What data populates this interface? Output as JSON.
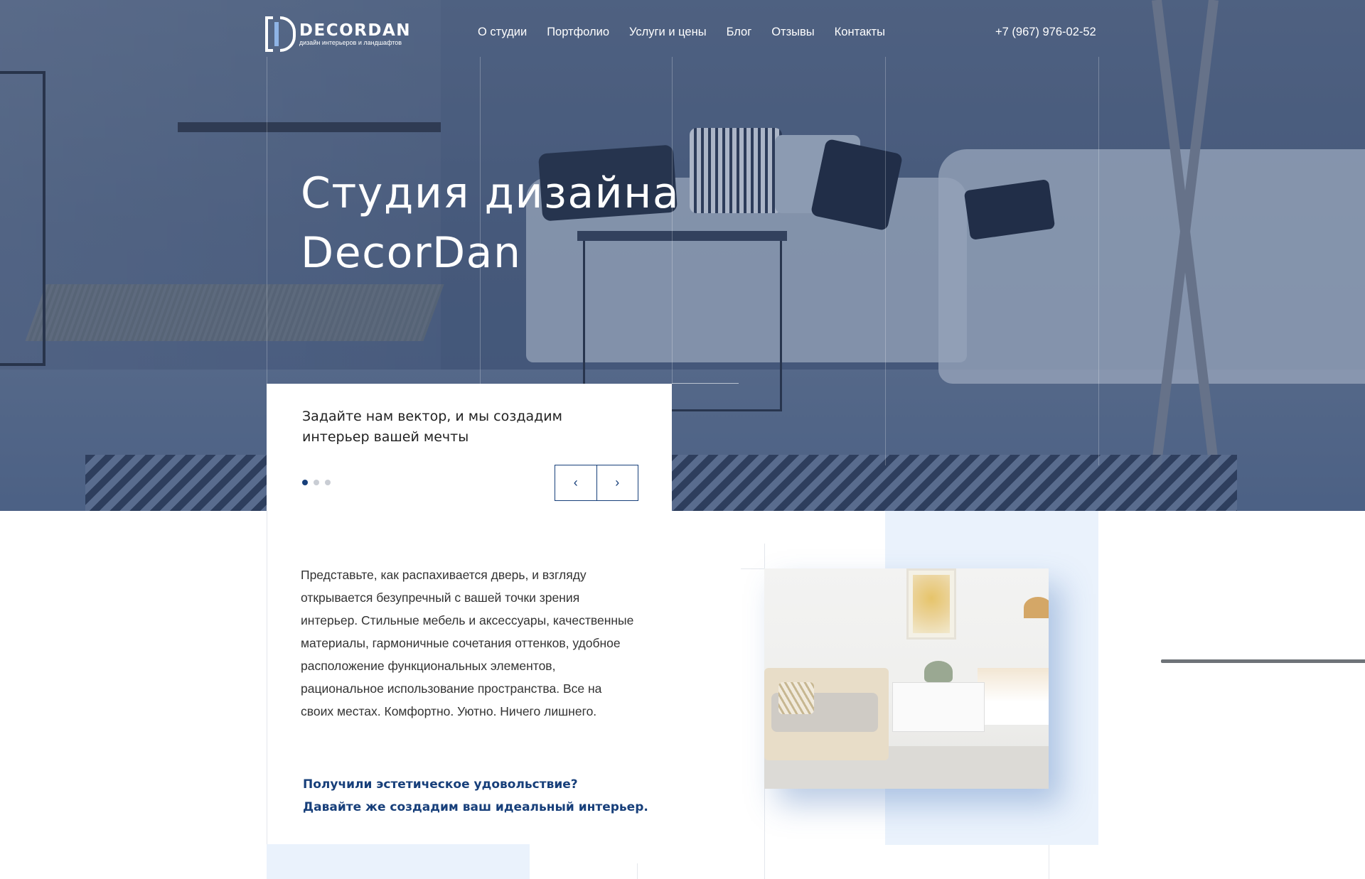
{
  "brand": {
    "name": "DECORDAN",
    "tagline": "дизайн интерьеров и ландшафтов"
  },
  "nav": {
    "items": [
      "О студии",
      "Портфолио",
      "Услуги и цены",
      "Блог",
      "Отзывы",
      "Контакты"
    ]
  },
  "header": {
    "phone": "+7 (967) 976-02-52"
  },
  "hero": {
    "title_line1": "Студия дизайна",
    "title_line2": "DecorDan"
  },
  "slider": {
    "text_line1": "Задайте нам вектор, и мы создадим",
    "text_line2": "интерьер вашей мечты",
    "current_slide": 1,
    "total_slides": 3,
    "prev_icon": "chevron-left-icon",
    "next_icon": "chevron-right-icon",
    "prev_glyph": "‹",
    "next_glyph": "›"
  },
  "about": {
    "paragraph": "Представьте, как распахивается дверь, и взгляду открывается безупречный с вашей точки зрения интерьер. Стильные мебель и аксессуары, качественные материалы, гармоничные сочетания оттенков, удобное расположение функциональных элементов, рациональное использование пространства. Все на своих местах. Комфортно. Уютно. Ничего лишнего.",
    "cta_line1": "Получили эстетическое удовольствие?",
    "cta_line2": "Давайте же создадим ваш идеальный интерьер."
  },
  "colors": {
    "accent": "#173f7a",
    "light_blue": "#eaf2fc",
    "hero_overlay": "#3a5078"
  }
}
